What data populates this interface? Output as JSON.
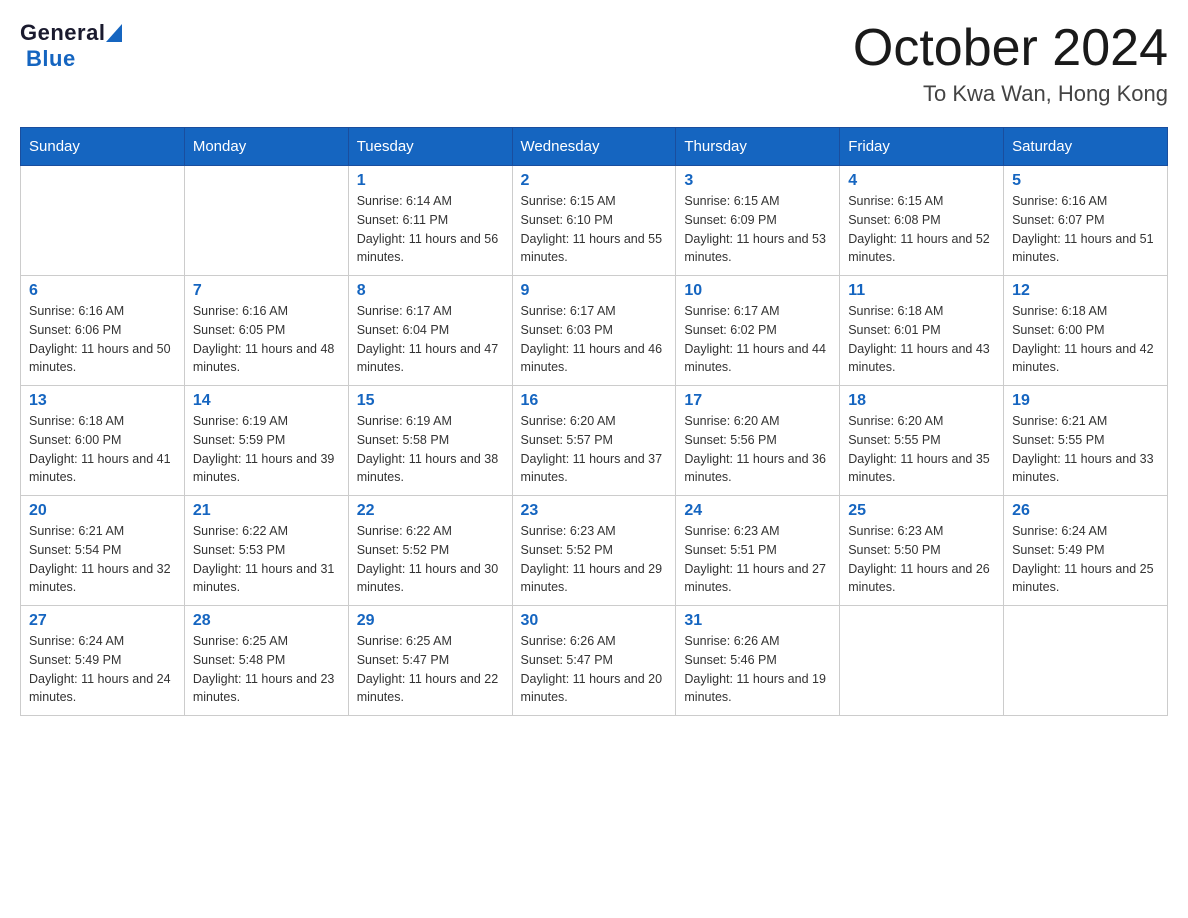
{
  "header": {
    "logo": {
      "general": "General",
      "blue": "Blue",
      "triangle_alt": "triangle logo"
    },
    "month_title": "October 2024",
    "location": "To Kwa Wan, Hong Kong"
  },
  "days_of_week": [
    "Sunday",
    "Monday",
    "Tuesday",
    "Wednesday",
    "Thursday",
    "Friday",
    "Saturday"
  ],
  "weeks": [
    [
      {
        "day": "",
        "sunrise": "",
        "sunset": "",
        "daylight": ""
      },
      {
        "day": "",
        "sunrise": "",
        "sunset": "",
        "daylight": ""
      },
      {
        "day": "1",
        "sunrise": "Sunrise: 6:14 AM",
        "sunset": "Sunset: 6:11 PM",
        "daylight": "Daylight: 11 hours and 56 minutes."
      },
      {
        "day": "2",
        "sunrise": "Sunrise: 6:15 AM",
        "sunset": "Sunset: 6:10 PM",
        "daylight": "Daylight: 11 hours and 55 minutes."
      },
      {
        "day": "3",
        "sunrise": "Sunrise: 6:15 AM",
        "sunset": "Sunset: 6:09 PM",
        "daylight": "Daylight: 11 hours and 53 minutes."
      },
      {
        "day": "4",
        "sunrise": "Sunrise: 6:15 AM",
        "sunset": "Sunset: 6:08 PM",
        "daylight": "Daylight: 11 hours and 52 minutes."
      },
      {
        "day": "5",
        "sunrise": "Sunrise: 6:16 AM",
        "sunset": "Sunset: 6:07 PM",
        "daylight": "Daylight: 11 hours and 51 minutes."
      }
    ],
    [
      {
        "day": "6",
        "sunrise": "Sunrise: 6:16 AM",
        "sunset": "Sunset: 6:06 PM",
        "daylight": "Daylight: 11 hours and 50 minutes."
      },
      {
        "day": "7",
        "sunrise": "Sunrise: 6:16 AM",
        "sunset": "Sunset: 6:05 PM",
        "daylight": "Daylight: 11 hours and 48 minutes."
      },
      {
        "day": "8",
        "sunrise": "Sunrise: 6:17 AM",
        "sunset": "Sunset: 6:04 PM",
        "daylight": "Daylight: 11 hours and 47 minutes."
      },
      {
        "day": "9",
        "sunrise": "Sunrise: 6:17 AM",
        "sunset": "Sunset: 6:03 PM",
        "daylight": "Daylight: 11 hours and 46 minutes."
      },
      {
        "day": "10",
        "sunrise": "Sunrise: 6:17 AM",
        "sunset": "Sunset: 6:02 PM",
        "daylight": "Daylight: 11 hours and 44 minutes."
      },
      {
        "day": "11",
        "sunrise": "Sunrise: 6:18 AM",
        "sunset": "Sunset: 6:01 PM",
        "daylight": "Daylight: 11 hours and 43 minutes."
      },
      {
        "day": "12",
        "sunrise": "Sunrise: 6:18 AM",
        "sunset": "Sunset: 6:00 PM",
        "daylight": "Daylight: 11 hours and 42 minutes."
      }
    ],
    [
      {
        "day": "13",
        "sunrise": "Sunrise: 6:18 AM",
        "sunset": "Sunset: 6:00 PM",
        "daylight": "Daylight: 11 hours and 41 minutes."
      },
      {
        "day": "14",
        "sunrise": "Sunrise: 6:19 AM",
        "sunset": "Sunset: 5:59 PM",
        "daylight": "Daylight: 11 hours and 39 minutes."
      },
      {
        "day": "15",
        "sunrise": "Sunrise: 6:19 AM",
        "sunset": "Sunset: 5:58 PM",
        "daylight": "Daylight: 11 hours and 38 minutes."
      },
      {
        "day": "16",
        "sunrise": "Sunrise: 6:20 AM",
        "sunset": "Sunset: 5:57 PM",
        "daylight": "Daylight: 11 hours and 37 minutes."
      },
      {
        "day": "17",
        "sunrise": "Sunrise: 6:20 AM",
        "sunset": "Sunset: 5:56 PM",
        "daylight": "Daylight: 11 hours and 36 minutes."
      },
      {
        "day": "18",
        "sunrise": "Sunrise: 6:20 AM",
        "sunset": "Sunset: 5:55 PM",
        "daylight": "Daylight: 11 hours and 35 minutes."
      },
      {
        "day": "19",
        "sunrise": "Sunrise: 6:21 AM",
        "sunset": "Sunset: 5:55 PM",
        "daylight": "Daylight: 11 hours and 33 minutes."
      }
    ],
    [
      {
        "day": "20",
        "sunrise": "Sunrise: 6:21 AM",
        "sunset": "Sunset: 5:54 PM",
        "daylight": "Daylight: 11 hours and 32 minutes."
      },
      {
        "day": "21",
        "sunrise": "Sunrise: 6:22 AM",
        "sunset": "Sunset: 5:53 PM",
        "daylight": "Daylight: 11 hours and 31 minutes."
      },
      {
        "day": "22",
        "sunrise": "Sunrise: 6:22 AM",
        "sunset": "Sunset: 5:52 PM",
        "daylight": "Daylight: 11 hours and 30 minutes."
      },
      {
        "day": "23",
        "sunrise": "Sunrise: 6:23 AM",
        "sunset": "Sunset: 5:52 PM",
        "daylight": "Daylight: 11 hours and 29 minutes."
      },
      {
        "day": "24",
        "sunrise": "Sunrise: 6:23 AM",
        "sunset": "Sunset: 5:51 PM",
        "daylight": "Daylight: 11 hours and 27 minutes."
      },
      {
        "day": "25",
        "sunrise": "Sunrise: 6:23 AM",
        "sunset": "Sunset: 5:50 PM",
        "daylight": "Daylight: 11 hours and 26 minutes."
      },
      {
        "day": "26",
        "sunrise": "Sunrise: 6:24 AM",
        "sunset": "Sunset: 5:49 PM",
        "daylight": "Daylight: 11 hours and 25 minutes."
      }
    ],
    [
      {
        "day": "27",
        "sunrise": "Sunrise: 6:24 AM",
        "sunset": "Sunset: 5:49 PM",
        "daylight": "Daylight: 11 hours and 24 minutes."
      },
      {
        "day": "28",
        "sunrise": "Sunrise: 6:25 AM",
        "sunset": "Sunset: 5:48 PM",
        "daylight": "Daylight: 11 hours and 23 minutes."
      },
      {
        "day": "29",
        "sunrise": "Sunrise: 6:25 AM",
        "sunset": "Sunset: 5:47 PM",
        "daylight": "Daylight: 11 hours and 22 minutes."
      },
      {
        "day": "30",
        "sunrise": "Sunrise: 6:26 AM",
        "sunset": "Sunset: 5:47 PM",
        "daylight": "Daylight: 11 hours and 20 minutes."
      },
      {
        "day": "31",
        "sunrise": "Sunrise: 6:26 AM",
        "sunset": "Sunset: 5:46 PM",
        "daylight": "Daylight: 11 hours and 19 minutes."
      },
      {
        "day": "",
        "sunrise": "",
        "sunset": "",
        "daylight": ""
      },
      {
        "day": "",
        "sunrise": "",
        "sunset": "",
        "daylight": ""
      }
    ]
  ]
}
